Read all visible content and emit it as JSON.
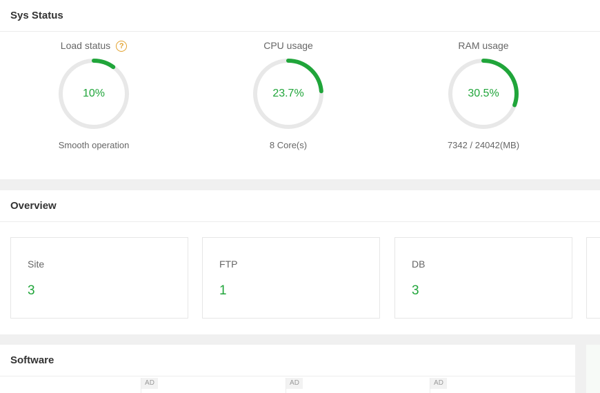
{
  "sys_status": {
    "title": "Sys Status",
    "gauges": [
      {
        "label": "Load status",
        "value_text": "10%",
        "percent": 10,
        "sub": "Smooth operation",
        "has_help": true
      },
      {
        "label": "CPU usage",
        "value_text": "23.7%",
        "percent": 23.7,
        "sub": "8 Core(s)"
      },
      {
        "label": "RAM usage",
        "value_text": "30.5%",
        "percent": 30.5,
        "sub": "7342 / 24042(MB)"
      }
    ],
    "help_glyph": "?"
  },
  "overview": {
    "title": "Overview",
    "cards": [
      {
        "label": "Site",
        "value": "3"
      },
      {
        "label": "FTP",
        "value": "1"
      },
      {
        "label": "DB",
        "value": "3"
      }
    ]
  },
  "software": {
    "title": "Software",
    "ad_label": "AD"
  },
  "colors": {
    "accent": "#20a53a",
    "ring_track": "#e8e8e8",
    "help": "#e2a12c"
  }
}
